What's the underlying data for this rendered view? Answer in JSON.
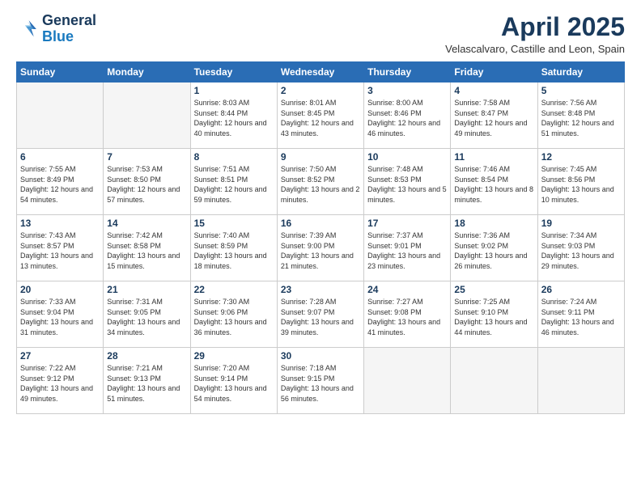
{
  "logo": {
    "line1": "General",
    "line2": "Blue"
  },
  "title": "April 2025",
  "location": "Velascalvaro, Castille and Leon, Spain",
  "days_header": [
    "Sunday",
    "Monday",
    "Tuesday",
    "Wednesday",
    "Thursday",
    "Friday",
    "Saturday"
  ],
  "weeks": [
    [
      {
        "day": "",
        "sunrise": "",
        "sunset": "",
        "daylight": ""
      },
      {
        "day": "",
        "sunrise": "",
        "sunset": "",
        "daylight": ""
      },
      {
        "day": "1",
        "sunrise": "Sunrise: 8:03 AM",
        "sunset": "Sunset: 8:44 PM",
        "daylight": "Daylight: 12 hours and 40 minutes."
      },
      {
        "day": "2",
        "sunrise": "Sunrise: 8:01 AM",
        "sunset": "Sunset: 8:45 PM",
        "daylight": "Daylight: 12 hours and 43 minutes."
      },
      {
        "day": "3",
        "sunrise": "Sunrise: 8:00 AM",
        "sunset": "Sunset: 8:46 PM",
        "daylight": "Daylight: 12 hours and 46 minutes."
      },
      {
        "day": "4",
        "sunrise": "Sunrise: 7:58 AM",
        "sunset": "Sunset: 8:47 PM",
        "daylight": "Daylight: 12 hours and 49 minutes."
      },
      {
        "day": "5",
        "sunrise": "Sunrise: 7:56 AM",
        "sunset": "Sunset: 8:48 PM",
        "daylight": "Daylight: 12 hours and 51 minutes."
      }
    ],
    [
      {
        "day": "6",
        "sunrise": "Sunrise: 7:55 AM",
        "sunset": "Sunset: 8:49 PM",
        "daylight": "Daylight: 12 hours and 54 minutes."
      },
      {
        "day": "7",
        "sunrise": "Sunrise: 7:53 AM",
        "sunset": "Sunset: 8:50 PM",
        "daylight": "Daylight: 12 hours and 57 minutes."
      },
      {
        "day": "8",
        "sunrise": "Sunrise: 7:51 AM",
        "sunset": "Sunset: 8:51 PM",
        "daylight": "Daylight: 12 hours and 59 minutes."
      },
      {
        "day": "9",
        "sunrise": "Sunrise: 7:50 AM",
        "sunset": "Sunset: 8:52 PM",
        "daylight": "Daylight: 13 hours and 2 minutes."
      },
      {
        "day": "10",
        "sunrise": "Sunrise: 7:48 AM",
        "sunset": "Sunset: 8:53 PM",
        "daylight": "Daylight: 13 hours and 5 minutes."
      },
      {
        "day": "11",
        "sunrise": "Sunrise: 7:46 AM",
        "sunset": "Sunset: 8:54 PM",
        "daylight": "Daylight: 13 hours and 8 minutes."
      },
      {
        "day": "12",
        "sunrise": "Sunrise: 7:45 AM",
        "sunset": "Sunset: 8:56 PM",
        "daylight": "Daylight: 13 hours and 10 minutes."
      }
    ],
    [
      {
        "day": "13",
        "sunrise": "Sunrise: 7:43 AM",
        "sunset": "Sunset: 8:57 PM",
        "daylight": "Daylight: 13 hours and 13 minutes."
      },
      {
        "day": "14",
        "sunrise": "Sunrise: 7:42 AM",
        "sunset": "Sunset: 8:58 PM",
        "daylight": "Daylight: 13 hours and 15 minutes."
      },
      {
        "day": "15",
        "sunrise": "Sunrise: 7:40 AM",
        "sunset": "Sunset: 8:59 PM",
        "daylight": "Daylight: 13 hours and 18 minutes."
      },
      {
        "day": "16",
        "sunrise": "Sunrise: 7:39 AM",
        "sunset": "Sunset: 9:00 PM",
        "daylight": "Daylight: 13 hours and 21 minutes."
      },
      {
        "day": "17",
        "sunrise": "Sunrise: 7:37 AM",
        "sunset": "Sunset: 9:01 PM",
        "daylight": "Daylight: 13 hours and 23 minutes."
      },
      {
        "day": "18",
        "sunrise": "Sunrise: 7:36 AM",
        "sunset": "Sunset: 9:02 PM",
        "daylight": "Daylight: 13 hours and 26 minutes."
      },
      {
        "day": "19",
        "sunrise": "Sunrise: 7:34 AM",
        "sunset": "Sunset: 9:03 PM",
        "daylight": "Daylight: 13 hours and 29 minutes."
      }
    ],
    [
      {
        "day": "20",
        "sunrise": "Sunrise: 7:33 AM",
        "sunset": "Sunset: 9:04 PM",
        "daylight": "Daylight: 13 hours and 31 minutes."
      },
      {
        "day": "21",
        "sunrise": "Sunrise: 7:31 AM",
        "sunset": "Sunset: 9:05 PM",
        "daylight": "Daylight: 13 hours and 34 minutes."
      },
      {
        "day": "22",
        "sunrise": "Sunrise: 7:30 AM",
        "sunset": "Sunset: 9:06 PM",
        "daylight": "Daylight: 13 hours and 36 minutes."
      },
      {
        "day": "23",
        "sunrise": "Sunrise: 7:28 AM",
        "sunset": "Sunset: 9:07 PM",
        "daylight": "Daylight: 13 hours and 39 minutes."
      },
      {
        "day": "24",
        "sunrise": "Sunrise: 7:27 AM",
        "sunset": "Sunset: 9:08 PM",
        "daylight": "Daylight: 13 hours and 41 minutes."
      },
      {
        "day": "25",
        "sunrise": "Sunrise: 7:25 AM",
        "sunset": "Sunset: 9:10 PM",
        "daylight": "Daylight: 13 hours and 44 minutes."
      },
      {
        "day": "26",
        "sunrise": "Sunrise: 7:24 AM",
        "sunset": "Sunset: 9:11 PM",
        "daylight": "Daylight: 13 hours and 46 minutes."
      }
    ],
    [
      {
        "day": "27",
        "sunrise": "Sunrise: 7:22 AM",
        "sunset": "Sunset: 9:12 PM",
        "daylight": "Daylight: 13 hours and 49 minutes."
      },
      {
        "day": "28",
        "sunrise": "Sunrise: 7:21 AM",
        "sunset": "Sunset: 9:13 PM",
        "daylight": "Daylight: 13 hours and 51 minutes."
      },
      {
        "day": "29",
        "sunrise": "Sunrise: 7:20 AM",
        "sunset": "Sunset: 9:14 PM",
        "daylight": "Daylight: 13 hours and 54 minutes."
      },
      {
        "day": "30",
        "sunrise": "Sunrise: 7:18 AM",
        "sunset": "Sunset: 9:15 PM",
        "daylight": "Daylight: 13 hours and 56 minutes."
      },
      {
        "day": "",
        "sunrise": "",
        "sunset": "",
        "daylight": ""
      },
      {
        "day": "",
        "sunrise": "",
        "sunset": "",
        "daylight": ""
      },
      {
        "day": "",
        "sunrise": "",
        "sunset": "",
        "daylight": ""
      }
    ]
  ]
}
